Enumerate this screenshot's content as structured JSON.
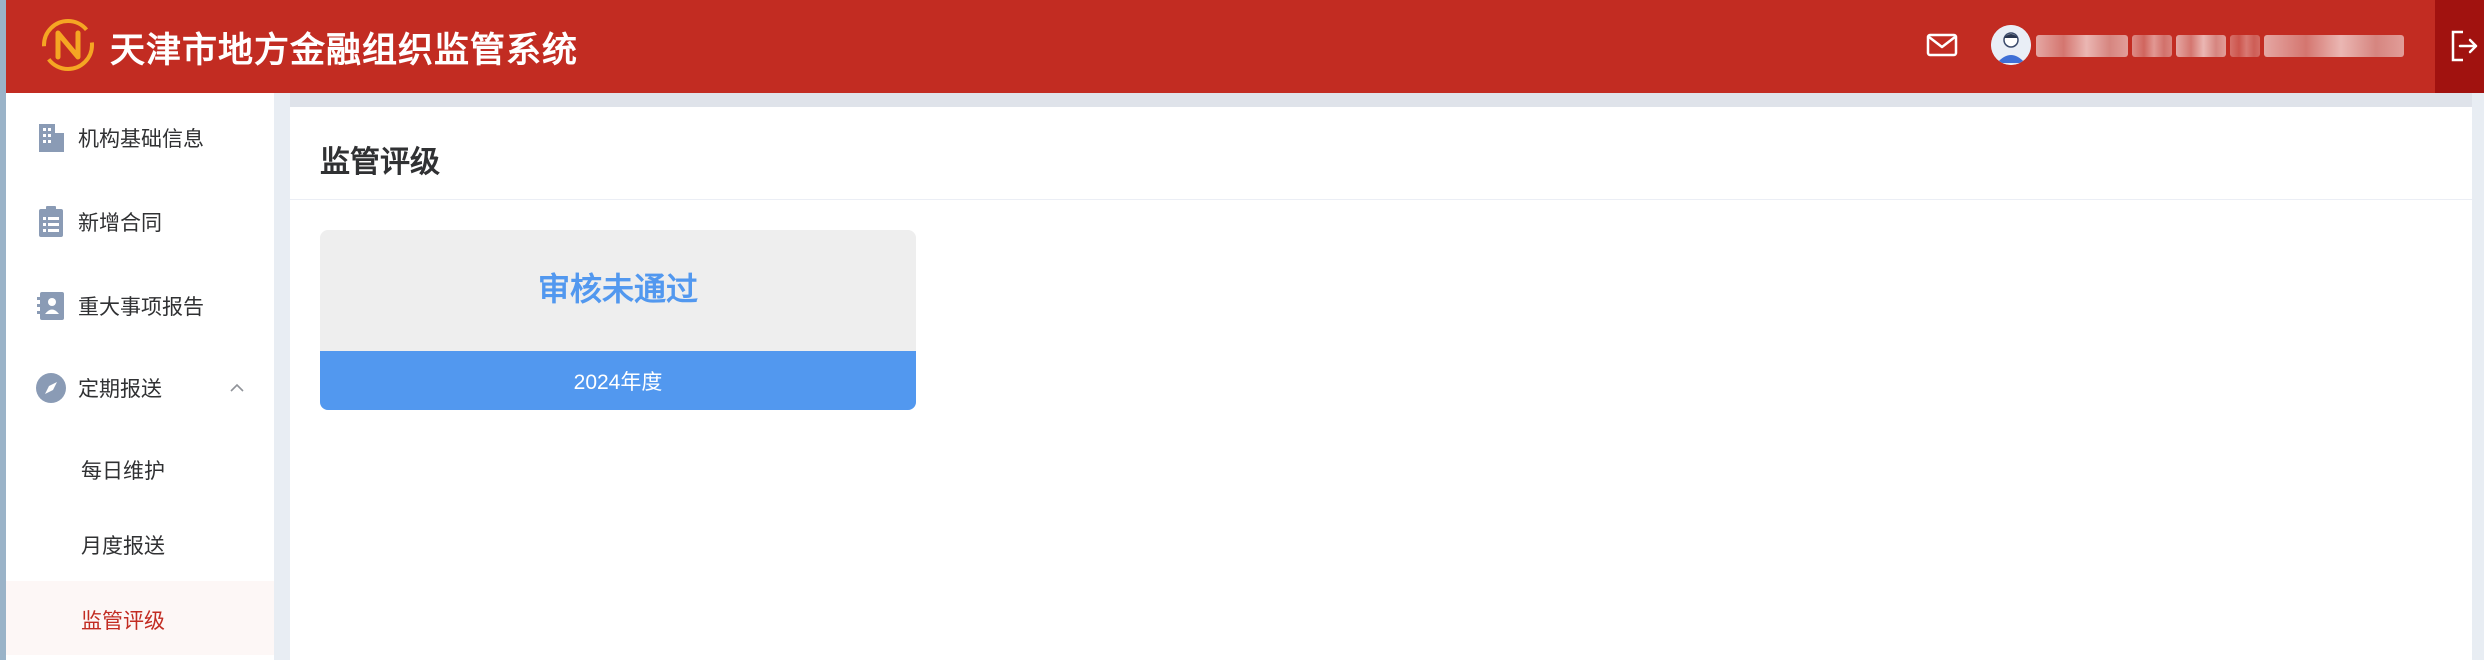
{
  "header": {
    "title": "天津市地方金融组织监管系统",
    "logo_icon": "stylized-n-logo-icon",
    "mail_icon": "mail-icon",
    "avatar_icon": "user-avatar-icon",
    "user_name": "",
    "logout_icon": "logout-icon",
    "colors": {
      "brand": "#c22c22",
      "logout_bg": "#a1120f"
    }
  },
  "sidebar": {
    "items": [
      {
        "label": "机构基础信息",
        "icon": "building-icon"
      },
      {
        "label": "新增合同",
        "icon": "clipboard-list-icon"
      },
      {
        "label": "重大事项报告",
        "icon": "contact-book-icon"
      },
      {
        "label": "定期报送",
        "icon": "compass-icon",
        "expanded": true
      }
    ],
    "subitems": [
      {
        "label": "每日维护"
      },
      {
        "label": "月度报送"
      },
      {
        "label": "监管评级",
        "active": true
      }
    ]
  },
  "main": {
    "title": "监管评级",
    "card": {
      "status": "审核未通过",
      "year": "2024年度"
    },
    "colors": {
      "accent": "#5298ef"
    }
  }
}
